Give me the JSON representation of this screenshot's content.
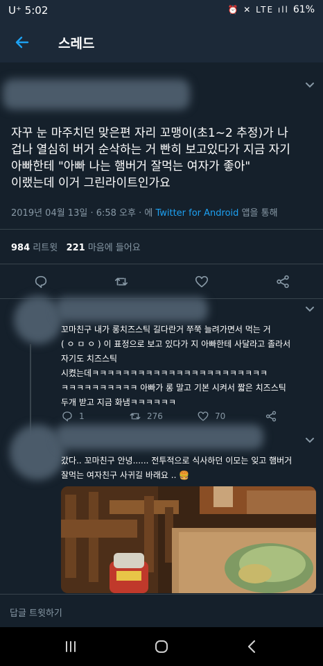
{
  "status_bar": {
    "carrier": "U⁺",
    "time": "5:02",
    "icons": "⏰ ✕ LTE ıll",
    "battery": "61%"
  },
  "app_bar": {
    "title": "스레드"
  },
  "tweet": {
    "text_lines": [
      "자꾸 눈 마주치던 맞은편 자리 꼬맹이(초1~2 추정)가 나",
      "겁나 열심히 버거 순삭하는 거 빤히 보고있다가 지금 자기",
      "아빠한테 \"아빠 나는 햄버거 잘먹는 여자가 좋아\"",
      "이랬는데 이거 그린라이트인가요"
    ],
    "timestamp": "2019년 04월 13일 · 6:58 오후 · 에 ",
    "source": "Twitter for Android",
    "source_suffix": " 앱을 통해",
    "retweets_count": "984",
    "retweets_label": " 리트윗 ",
    "likes_count": "221",
    "likes_label": " 마음에 들어요"
  },
  "reply1": {
    "text_lines": [
      "꼬마친구 내가 롱치즈스틱 길다란거 쭈쭉 늘려가면서 먹는 거",
      "( ㅇ ㅁ ㅇ ) 이 표정으로 보고 있다가 지 아빠한테 사달라고 졸라서",
      "자기도 치즈스틱",
      "시켰는데ㅋㅋㅋㅋㅋㅋㅋㅋㅋㅋㅋㅋㅋㅋㅋㅋㅋㅋㅋㅋㅋㅋㅋ",
      "ㅋㅋㅋㅋㅋㅋㅋㅋㅋㅋ 아빠가 롱 말고 기본 시켜서 짧은 치즈스틱",
      "두개 받고 지금 화냄ㅋㅋㅋㅋㅋㅋ"
    ],
    "replies": "1",
    "retweets": "276",
    "likes": "70"
  },
  "reply2": {
    "text_lines": [
      "갔다.. 꼬마친구 안녕...... 전투적으로 식사하던 이모는 잊고 햄버거",
      "잘먹는 여자친구 사귀길 바래요 .. 🍔"
    ]
  },
  "compose": {
    "placeholder": "답글 트윗하기"
  },
  "colors": {
    "background": "#15202b",
    "bar": "#1c2938",
    "accent": "#1da1f2",
    "secondary_text": "#8899a6",
    "divider": "#38444d"
  },
  "icons": [
    "back-arrow-icon",
    "chevron-down-icon",
    "reply-icon",
    "retweet-icon",
    "heart-icon",
    "share-icon",
    "recents-icon",
    "home-icon",
    "back-nav-icon"
  ]
}
